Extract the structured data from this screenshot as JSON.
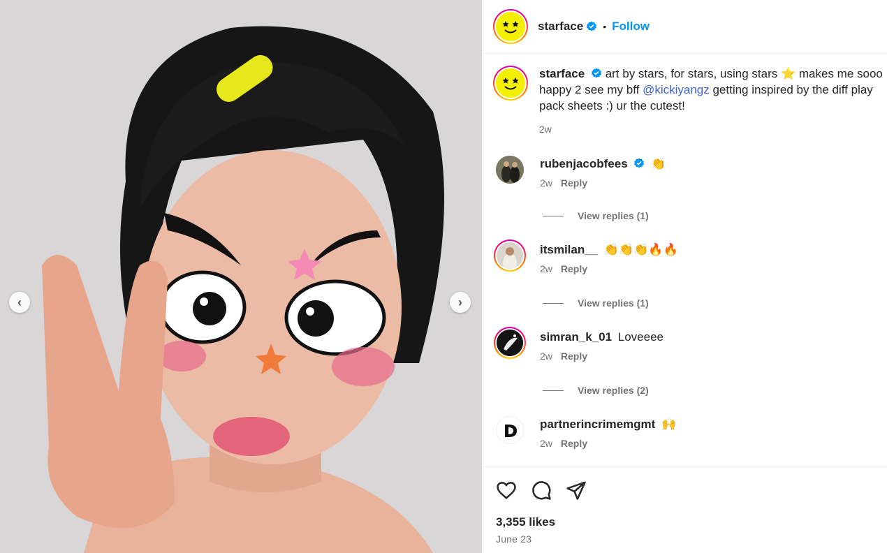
{
  "post": {
    "author": "starface",
    "follow_label": "Follow",
    "separator": "•",
    "caption": {
      "username": "starface",
      "text_before": "art by stars, for stars, using stars ⭐ makes me sooo happy 2 see my bff ",
      "mention": "@kickiyangz",
      "text_after": " getting inspired by the diff play pack sheets :) ur the cutest!",
      "time": "2w"
    },
    "likes": "3,355 likes",
    "date": "June 23"
  },
  "comments": [
    {
      "username": "rubenjacobfees",
      "verified": true,
      "text": "👏",
      "time": "2w",
      "reply_label": "Reply",
      "view_replies": "View replies (1)"
    },
    {
      "username": "itsmilan__",
      "verified": false,
      "text": "👏👏👏🔥🔥",
      "time": "2w",
      "reply_label": "Reply",
      "view_replies": "View replies (1)"
    },
    {
      "username": "simran_k_01",
      "verified": false,
      "text": "Loveeee",
      "time": "2w",
      "reply_label": "Reply",
      "view_replies": "View replies (2)"
    },
    {
      "username": "partnerincrimemgmt",
      "verified": false,
      "text": "🙌",
      "time": "2w",
      "reply_label": "Reply"
    }
  ],
  "colors": {
    "accent": "#0095f6",
    "mention": "#3e64d8",
    "verified": "#0095f6",
    "avatar_yellow": "#f5f000"
  },
  "icons": [
    "chevron-left-icon",
    "chevron-right-icon",
    "verified-badge-icon",
    "heart-icon",
    "comment-icon",
    "share-icon"
  ]
}
